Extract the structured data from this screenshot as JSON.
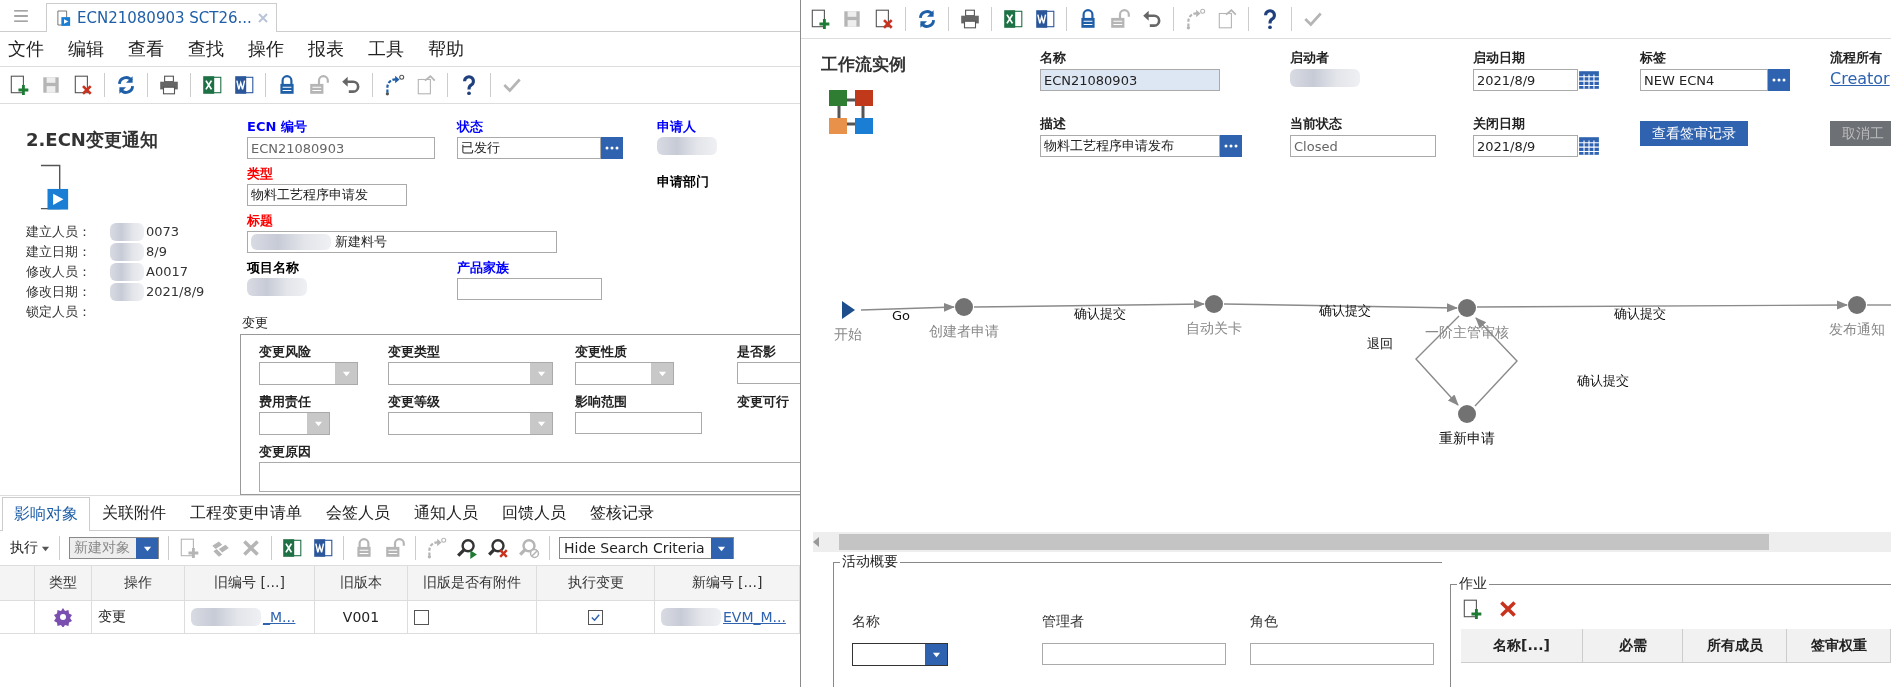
{
  "doc_tab": {
    "title": "ECN21080903 SCT26..."
  },
  "menu": [
    "文件",
    "编辑",
    "查看",
    "查找",
    "操作",
    "报表",
    "工具",
    "帮助"
  ],
  "toolbar": [
    {
      "kind": "new",
      "disabled": false
    },
    {
      "kind": "save",
      "disabled": true
    },
    {
      "kind": "delete",
      "disabled": false
    },
    {
      "kind": "separator"
    },
    {
      "kind": "refresh",
      "disabled": false
    },
    {
      "kind": "separator"
    },
    {
      "kind": "print",
      "disabled": false
    },
    {
      "kind": "separator"
    },
    {
      "kind": "excel",
      "disabled": false
    },
    {
      "kind": "word",
      "disabled": false
    },
    {
      "kind": "separator"
    },
    {
      "kind": "lock",
      "disabled": false
    },
    {
      "kind": "unlock",
      "disabled": true
    },
    {
      "kind": "undo",
      "disabled": false
    },
    {
      "kind": "separator"
    },
    {
      "kind": "route",
      "disabled": false
    },
    {
      "kind": "copy",
      "disabled": true
    },
    {
      "kind": "separator"
    },
    {
      "kind": "help",
      "disabled": false
    },
    {
      "kind": "separator"
    },
    {
      "kind": "check",
      "disabled": true
    }
  ],
  "form": {
    "title": "2.ECN变更通知",
    "meta": [
      {
        "label": "建立人员：",
        "value": "0073"
      },
      {
        "label": "建立日期：",
        "value": "8/9"
      },
      {
        "label": "修改人员：",
        "value": "A0017"
      },
      {
        "label": "修改日期：",
        "value": "2021/8/9"
      },
      {
        "label": "锁定人员："
      }
    ],
    "fields": [
      {
        "label": "ECN 编号",
        "color": "#0000ff",
        "kind": "readonly",
        "value": "ECN21080903"
      },
      {
        "label": "状态",
        "color": "#0000ff",
        "kind": "picker",
        "value": "已发行"
      },
      {
        "label": "申请人",
        "color": "#0000ff",
        "kind": "blurred"
      },
      {
        "label": "类型",
        "color": "#ff0000",
        "kind": "text",
        "value": "物料工艺程序申请发"
      },
      {
        "label": "申请部门",
        "color": "#000000",
        "kind": "label"
      },
      {
        "label": "标题",
        "color": "#ff0000",
        "kind": "blurred_text",
        "value": "新建料号"
      },
      {
        "label": "项目名称",
        "color": "#000000",
        "kind": "blurred"
      },
      {
        "label": "产品家族",
        "color": "#0000ff",
        "kind": "blurred_input"
      }
    ]
  },
  "change": {
    "title": "变更",
    "fields": [
      {
        "label": "变更风险",
        "kind": "combo"
      },
      {
        "label": "变更类型",
        "kind": "combo"
      },
      {
        "label": "变更性质",
        "kind": "combo"
      },
      {
        "label": "是否影",
        "kind": "input"
      },
      {
        "label": "费用责任",
        "kind": "combo"
      },
      {
        "label": "变更等级",
        "kind": "combo"
      },
      {
        "label": "影响范围",
        "kind": "input"
      },
      {
        "label": "变更可行",
        "kind": "label"
      },
      {
        "label": "变更原因",
        "kind": "textarea"
      }
    ]
  },
  "bottom_tabs": [
    {
      "label": "影响对象",
      "selected": true
    },
    {
      "label": "关联附件",
      "selected": false
    },
    {
      "label": "工程变更申请单",
      "selected": false
    },
    {
      "label": "会签人员",
      "selected": false
    },
    {
      "label": "通知人员",
      "selected": false
    },
    {
      "label": "回馈人员",
      "selected": false
    },
    {
      "label": "签核记录",
      "selected": false
    }
  ],
  "bottom_toolbar": [
    {
      "kind": "menu",
      "label": "执行"
    },
    {
      "kind": "separator"
    },
    {
      "kind": "combo",
      "label": "新建对象",
      "disabled": true
    },
    {
      "kind": "separator"
    },
    {
      "kind": "add",
      "disabled": true
    },
    {
      "kind": "parts",
      "disabled": true
    },
    {
      "kind": "x",
      "disabled": true
    },
    {
      "kind": "separator"
    },
    {
      "kind": "excel",
      "disabled": false
    },
    {
      "kind": "word",
      "disabled": false
    },
    {
      "kind": "separator"
    },
    {
      "kind": "lock",
      "disabled": true
    },
    {
      "kind": "unlock",
      "disabled": true
    },
    {
      "kind": "separator"
    },
    {
      "kind": "route",
      "disabled": true
    },
    {
      "kind": "search-go",
      "disabled": false
    },
    {
      "kind": "search-clear",
      "disabled": false
    },
    {
      "kind": "search-off",
      "disabled": true
    },
    {
      "kind": "separator"
    },
    {
      "kind": "combo",
      "label": "Hide Search Criteria",
      "disabled": false
    }
  ],
  "affected_table": {
    "columns": [
      "类型",
      "操作",
      "旧编号 [...]",
      "旧版本",
      "旧版是否有附件",
      "执行变更",
      "新编号 [...]"
    ],
    "rows": [
      {
        "operation": "变更",
        "old_number": "_M...",
        "old_version": "V001",
        "old_has_attachment": false,
        "execute_change": true,
        "new_number": "EVM_M..."
      }
    ]
  },
  "workflow_toolbar": [
    {
      "kind": "new",
      "disabled": false
    },
    {
      "kind": "save",
      "disabled": true
    },
    {
      "kind": "delete",
      "disabled": false
    },
    {
      "kind": "separator"
    },
    {
      "kind": "refresh",
      "disabled": false
    },
    {
      "kind": "separator"
    },
    {
      "kind": "print",
      "disabled": false
    },
    {
      "kind": "separator"
    },
    {
      "kind": "excel",
      "disabled": false
    },
    {
      "kind": "word",
      "disabled": false
    },
    {
      "kind": "separator"
    },
    {
      "kind": "lock",
      "disabled": false
    },
    {
      "kind": "unlock",
      "disabled": true
    },
    {
      "kind": "undo",
      "disabled": false
    },
    {
      "kind": "separator"
    },
    {
      "kind": "route",
      "disabled": true
    },
    {
      "kind": "copy",
      "disabled": true
    },
    {
      "kind": "separator"
    },
    {
      "kind": "help",
      "disabled": false
    },
    {
      "kind": "separator"
    },
    {
      "kind": "check",
      "disabled": true
    }
  ],
  "workflow_instance": {
    "title": "工作流实例",
    "name": {
      "label": "名称",
      "value": "ECN21080903"
    },
    "description": {
      "label": "描述",
      "value": "物料工艺程序申请发布"
    },
    "starter": {
      "label": "启动者"
    },
    "current_state": {
      "label": "当前状态",
      "value": "Closed"
    },
    "start_date": {
      "label": "启动日期",
      "value": "2021/8/9"
    },
    "close_date": {
      "label": "关闭日期",
      "value": "2021/8/9"
    },
    "tag": {
      "label": "标签",
      "value": "NEW ECN4"
    },
    "view_log_button": "查看签审记录",
    "owner": {
      "label": "流程所有",
      "link": "Creator"
    },
    "cancel_button": {
      "label": "取消工",
      "disabled": true
    }
  },
  "workflow": {
    "nodes": [
      {
        "kind": "start",
        "label": "开始"
      },
      {
        "kind": "step",
        "label": "创建者申请"
      },
      {
        "kind": "step",
        "label": "自动关卡"
      },
      {
        "kind": "step",
        "label": "一阶主管审核"
      },
      {
        "kind": "step",
        "label": "发布通知"
      },
      {
        "kind": "step",
        "label": "重新申请"
      }
    ],
    "edges": [
      {
        "label": "Go"
      },
      {
        "label": "确认提交"
      },
      {
        "label": "确认提交"
      },
      {
        "label": "确认提交"
      },
      {
        "label": "退回"
      },
      {
        "label": "确认提交"
      }
    ]
  },
  "activity_summary": {
    "title": "活动概要",
    "fields": [
      {
        "label": "名称",
        "kind": "combo"
      },
      {
        "label": "管理者",
        "kind": "text"
      },
      {
        "label": "角色",
        "kind": "text"
      }
    ]
  },
  "jobs": {
    "title": "作业",
    "toolbar": [
      {
        "kind": "add",
        "disabled": false
      },
      {
        "kind": "x",
        "disabled": false
      }
    ],
    "columns": [
      "名称[...]",
      "必需",
      "所有成员",
      "签审权重"
    ]
  }
}
